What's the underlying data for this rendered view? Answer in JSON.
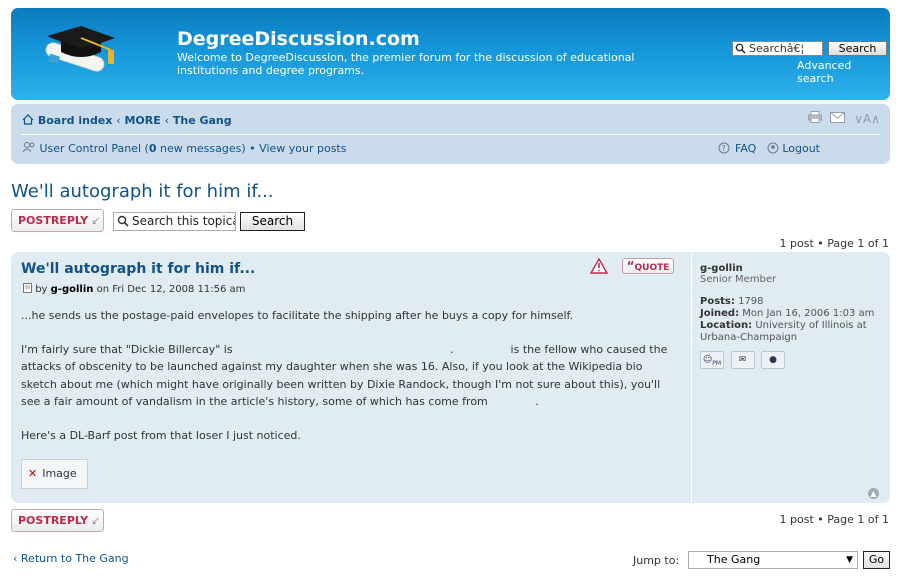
{
  "header": {
    "site_title": "DegreeDiscussion.com",
    "site_description": "Welcome to DegreeDiscussion, the premier forum for the discussion of educational institutions and degree programs.",
    "search_placeholder": "Searchâ€¦",
    "search_button": "Search",
    "advanced_search": "Advanced search",
    "logo_icon": "graduation-cap-diploma"
  },
  "navbar": {
    "breadcrumbs": [
      "Board index",
      "MORE",
      "The Gang"
    ],
    "separator": "‹",
    "ucp_label": "User Control Panel",
    "new_messages_count": "0",
    "new_messages_text": "new messages",
    "view_posts": "View your posts",
    "faq": "FAQ",
    "logout": "Logout",
    "font_size_tool": "A"
  },
  "topic": {
    "title": "We'll autograph it for him if...",
    "post_reply": "POSTREPLY",
    "search_placeholder": "Search this topicâ",
    "search_button": "Search",
    "pagination": "1 post • Page 1 of 1"
  },
  "post": {
    "title": "We'll autograph it for him if...",
    "by": "by",
    "author": "g-gollin",
    "date": "on Fri Dec 12, 2008 11:56 am",
    "quote_button": "QUOTE",
    "paragraph1": "...he sends us the postage-paid envelopes to facilitate the shipping after he buys a copy for himself.",
    "paragraph2_a": "I'm fairly sure that \"Dickie Billercay\" is",
    "paragraph2_b": "is the fellow who caused the attacks of obscenity to be launched against my daughter when she was 16. Also, if you look at the Wikipedia bio sketch about me (which might have originally been written by Dixie Randock, though I'm not sure about this), you'll see a fair amount of vandalism in the article's history, some of which has come from",
    "paragraph3": "Here's a DL-Barf post from that loser I just noticed.",
    "image_label": "Image"
  },
  "profile": {
    "username": "g-gollin",
    "rank": "Senior Member",
    "posts_label": "Posts:",
    "posts_value": "1798",
    "joined_label": "Joined:",
    "joined_value": "Mon Jan 16, 2006 1:03 am",
    "location_label": "Location:",
    "location_value": "University of Illinois at Urbana-Champaign",
    "pm_icon_text": "PM"
  },
  "footer": {
    "return_link": "Return to The Gang",
    "jump_label": "Jump to:",
    "jump_selected": "The Gang",
    "go_button": "Go"
  },
  "colors": {
    "header_gradient_top": "#0c7bbf",
    "header_gradient_bottom": "#2fb1ec",
    "navbar_bg": "#cadceb",
    "post_bg": "#e1ebf2",
    "link": "#105289",
    "post_reply": "#bc2a4d"
  }
}
